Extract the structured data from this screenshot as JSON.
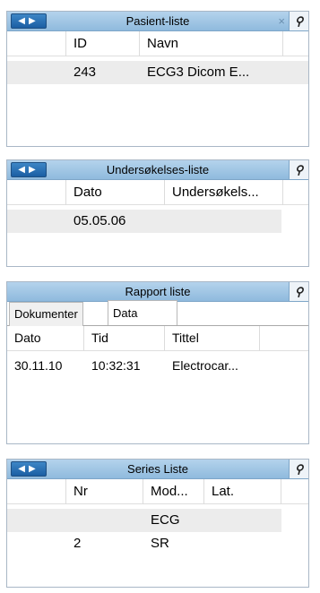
{
  "panels": {
    "pasient": {
      "title": "Pasient-liste",
      "nav_label": "◀▶",
      "close_label": "×",
      "pin_label": "⚲",
      "columns": [
        "ID",
        "Navn"
      ],
      "rows": [
        [
          "243",
          "ECG3 Dicom E..."
        ]
      ]
    },
    "undersokelse": {
      "title": "Undersøkelses-liste",
      "nav_label": "◀▶",
      "pin_label": "⚲",
      "columns": [
        "Dato",
        "Undersøkels..."
      ],
      "rows": [
        [
          "05.05.06"
        ]
      ]
    },
    "rapport": {
      "title": "Rapport liste",
      "pin_label": "⚲",
      "tabs": [
        "Dokumenter",
        "Data"
      ],
      "active_tab": "Data",
      "columns": [
        "Dato",
        "Tid",
        "Tittel"
      ],
      "rows": [
        [
          "30.11.10",
          "10:32:31",
          "Electrocar..."
        ]
      ]
    },
    "series": {
      "title": "Series Liste",
      "nav_label": "◀▶",
      "pin_label": "⚲",
      "columns": [
        "Nr",
        "Mod...",
        "Lat."
      ],
      "rows": [
        [
          "",
          "ECG"
        ],
        [
          "2",
          "SR"
        ]
      ]
    }
  }
}
